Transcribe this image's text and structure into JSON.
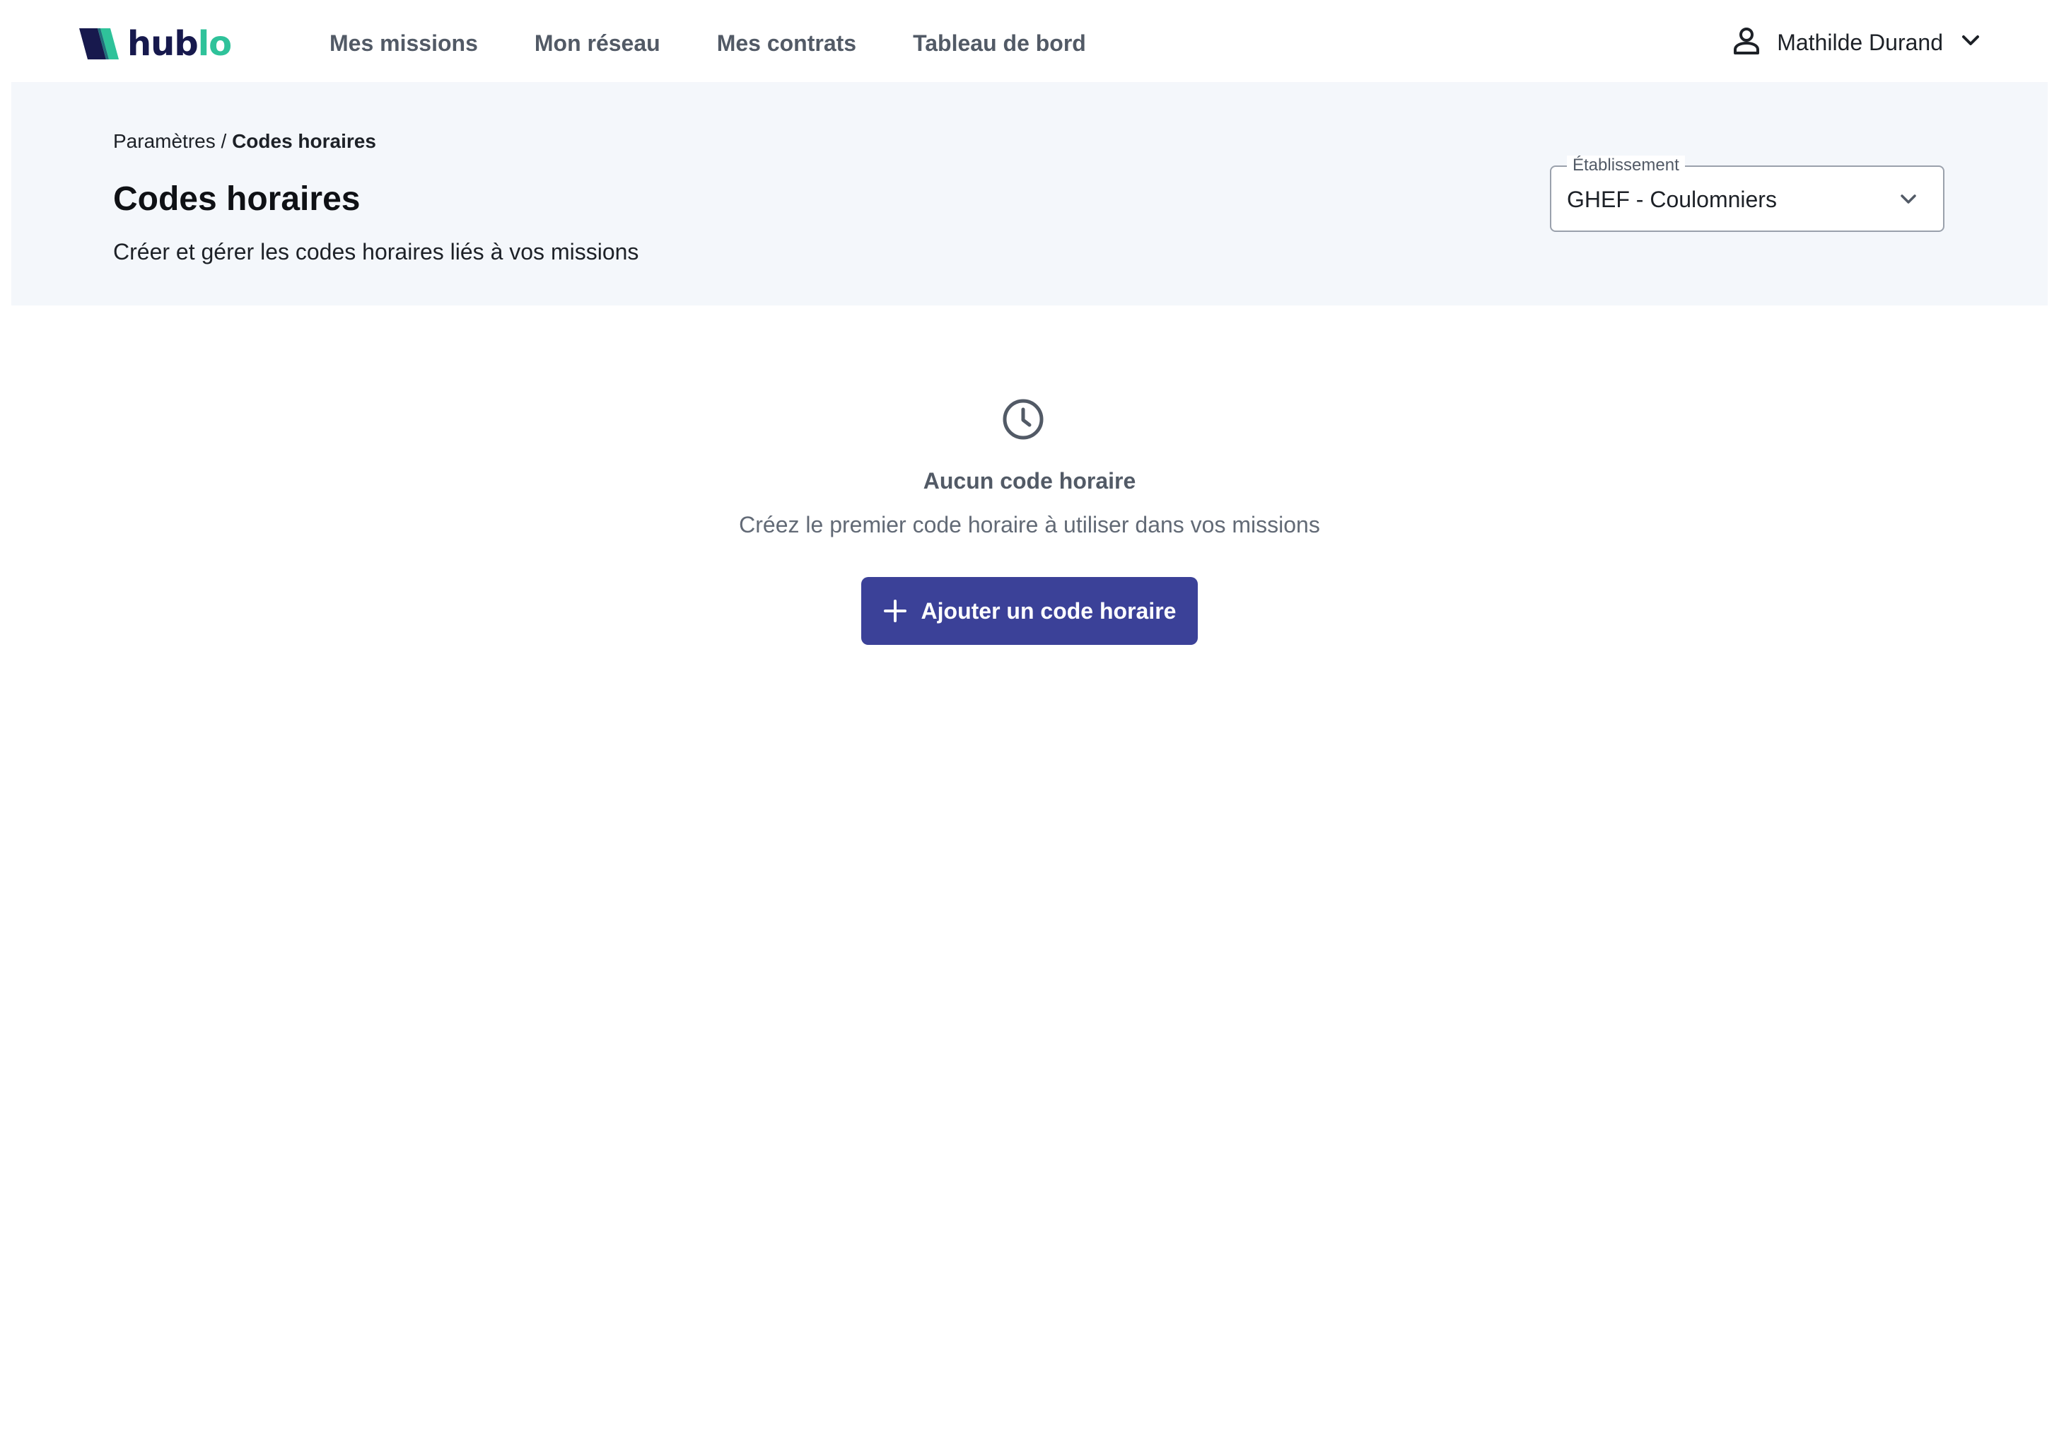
{
  "app": {
    "logo_text_dark": "hub",
    "logo_text_accent": "lo",
    "colors": {
      "brand_dark": "#17194d",
      "brand_green": "#2fc29a",
      "primary_button": "#3b4198",
      "header_band": "#f4f7fb"
    }
  },
  "nav": {
    "items": [
      {
        "label": "Mes missions"
      },
      {
        "label": "Mon réseau"
      },
      {
        "label": "Mes contrats"
      },
      {
        "label": "Tableau de bord"
      }
    ]
  },
  "user": {
    "name": "Mathilde Durand",
    "icon": "user-icon",
    "chevron_icon": "chevron-down-icon"
  },
  "header": {
    "breadcrumb_parent": "Paramètres",
    "breadcrumb_separator": " / ",
    "breadcrumb_current": "Codes horaires",
    "title": "Codes horaires",
    "subtitle": "Créer et gérer les codes horaires liés à vos missions"
  },
  "establishment_select": {
    "label": "Établissement",
    "value": "GHEF - Coulomniers",
    "icon": "chevron-down-icon"
  },
  "empty_state": {
    "icon": "clock-icon",
    "title": "Aucun code horaire",
    "description": "Créez le premier code horaire à utiliser dans vos missions",
    "button_label": "Ajouter un code horaire",
    "button_icon": "plus-icon"
  }
}
